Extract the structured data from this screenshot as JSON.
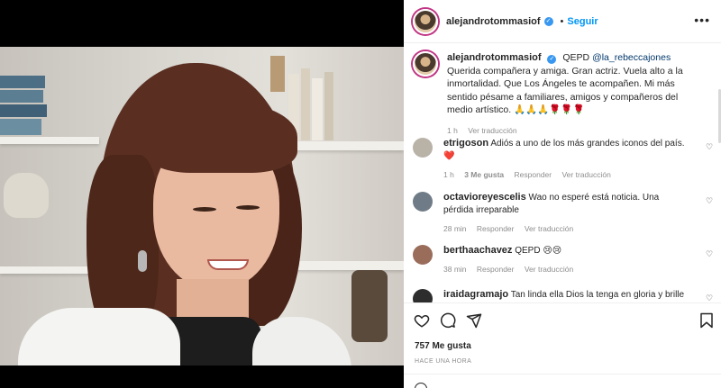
{
  "post": {
    "username": "alejandrotommasiof",
    "follow_label": "Seguir",
    "separator": "•"
  },
  "caption": {
    "username": "alejandrotommasiof",
    "text_before": "QEPD ",
    "mention": "@la_rebeccajones",
    "text_after": " Querida compañera y amiga. Gran actriz. Vuela alto a la inmortalidad. Que Los Ángeles te acompañen. Mi más sentido pésame a familiares, amigos y compañeros del medio artístico. 🙏🙏🙏🌹🌹🌹",
    "time": "1 h",
    "translate_label": "Ver traducción"
  },
  "comments": [
    {
      "username": "etrigoson",
      "text": "Adiós a uno de los más grandes iconos del país. ❤️",
      "time": "1 h",
      "likes": "3 Me gusta",
      "reply_label": "Responder",
      "translate_label": "Ver traducción",
      "avatar_color": "#b9b2a7"
    },
    {
      "username": "octavioreyescelis",
      "text": "Wao no esperé está noticia. Una pérdida irreparable",
      "time": "28 min",
      "reply_label": "Responder",
      "translate_label": "Ver traducción",
      "avatar_color": "#6f7c87"
    },
    {
      "username": "berthaachavez",
      "text": "QEPD 😢😢",
      "time": "38 min",
      "reply_label": "Responder",
      "translate_label": "Ver traducción",
      "avatar_color": "#9a6d5b"
    },
    {
      "username": "iraidagramajo",
      "text": "Tan linda ella Dios la tenga en gloria y brille",
      "avatar_color": "#2d2d2d"
    }
  ],
  "actions": {
    "likes_label": "757 Me gusta",
    "timestamp": "HACE UNA HORA"
  },
  "icons": {
    "like": "heart-icon",
    "comment": "comment-icon",
    "share": "share-icon",
    "save": "bookmark-icon",
    "verified": "verified-badge-icon",
    "more": "more-options-icon"
  },
  "colors": {
    "accent": "#0095f6",
    "mention": "#00376b",
    "muted": "#8e8e8e",
    "verified": "#3897f0"
  }
}
